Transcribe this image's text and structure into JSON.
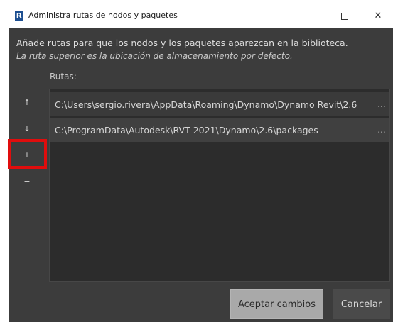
{
  "window": {
    "app_icon_letter": "R",
    "title": "Administra rutas de nodos y paquetes",
    "minimize_glyph": "—",
    "close_glyph": "✕"
  },
  "intro": {
    "line1": "Añade rutas para que los nodos y los paquetes aparezcan en la biblioteca.",
    "line2": "La ruta superior es la ubicación de almacenamiento por defecto."
  },
  "paths": {
    "label": "Rutas:",
    "items": [
      {
        "path": "C:\\Users\\sergio.rivera\\AppData\\Roaming\\Dynamo\\Dynamo Revit\\2.6",
        "more": "..."
      },
      {
        "path": "C:\\ProgramData\\Autodesk\\RVT 2021\\Dynamo\\2.6\\packages",
        "more": "..."
      }
    ]
  },
  "side_buttons": {
    "up": "↑",
    "down": "↓",
    "add": "+",
    "remove": "−"
  },
  "buttons": {
    "accept": "Aceptar cambios",
    "cancel": "Cancelar"
  },
  "colors": {
    "dialog_bg": "#3c3c3c",
    "panel_bg": "#2c2c2c",
    "highlight": "#e00d0d",
    "accept_bg": "#a9a9a9",
    "app_icon": "#1d4f91"
  },
  "icons": {
    "app": "revit-r-icon",
    "move_up": "arrow-up-icon",
    "move_down": "arrow-down-icon",
    "add": "plus-icon",
    "remove": "minus-icon"
  }
}
